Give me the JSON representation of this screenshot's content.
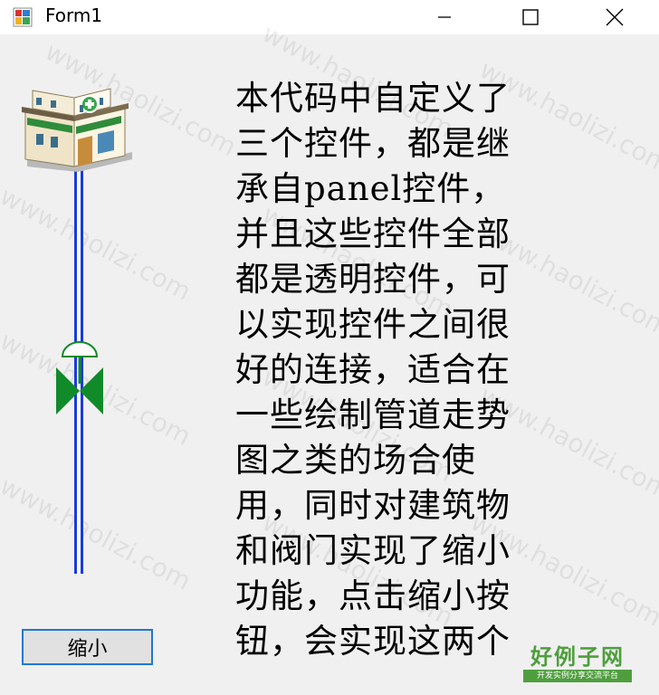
{
  "window": {
    "title": "Form1",
    "buttons": [
      "minimize",
      "maximize",
      "close"
    ]
  },
  "watermark": "www.haolizi.com",
  "description_text": "本代码中自定义了\n三个控件，都是继\n承自panel控件，\n并且这些控件全部\n都是透明控件，可\n以实现控件之间很\n好的连接，适合在\n一些绘制管道走势\n图之类的场合使\n用，同时对建筑物\n和阀门实现了缩小\n功能，点击缩小按\n钮，会实现这两个",
  "shrink_button": {
    "label": "缩小"
  },
  "logo": {
    "text": "好例子网",
    "subtext": "开发实例分享交流平台",
    "color": "#4f9e3e"
  },
  "icons": {
    "app": "form-app-icon",
    "building": "building-icon",
    "valve": "valve-icon",
    "pipe": "pipe-icon"
  },
  "colors": {
    "pipe": "#1a3bdc",
    "valve": "#118a2a",
    "button_border": "#1e78d7"
  }
}
